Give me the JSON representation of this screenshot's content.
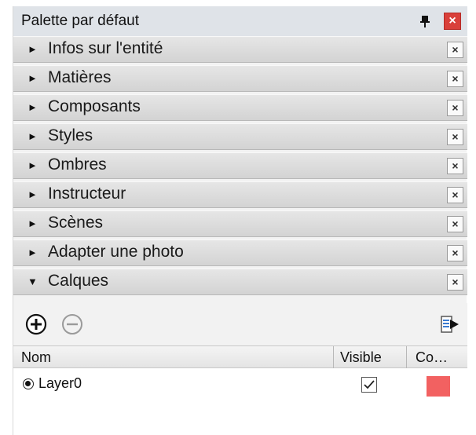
{
  "window": {
    "title": "Palette par défaut",
    "close_glyph": "×"
  },
  "trays": [
    {
      "label": "Infos sur l'entité",
      "expanded": false
    },
    {
      "label": "Matières",
      "expanded": false
    },
    {
      "label": "Composants",
      "expanded": false
    },
    {
      "label": "Styles",
      "expanded": false
    },
    {
      "label": "Ombres",
      "expanded": false
    },
    {
      "label": "Instructeur",
      "expanded": false
    },
    {
      "label": "Scènes",
      "expanded": false
    },
    {
      "label": "Adapter une photo",
      "expanded": false
    },
    {
      "label": "Calques",
      "expanded": true
    }
  ],
  "glyphs": {
    "collapsed_arrow": "►",
    "expanded_arrow": "▼",
    "tray_close": "×"
  },
  "layers": {
    "toolbar": {
      "add_icon": "add-layer-icon",
      "remove_icon": "remove-layer-icon",
      "details_icon": "details-arrow-icon"
    },
    "columns": {
      "name": "Nom",
      "visible": "Visible",
      "color": "Co…"
    },
    "rows": [
      {
        "name": "Layer0",
        "active": true,
        "visible": true,
        "color": "#f26161"
      }
    ]
  },
  "colors": {
    "close_button": "#d9403a",
    "layer0_color": "#f26161"
  }
}
